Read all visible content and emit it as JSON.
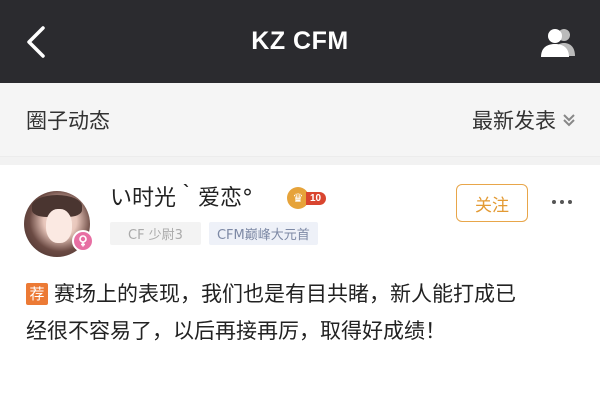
{
  "header": {
    "title": "KZ CFM",
    "back_icon": "chevron-left-icon",
    "members_icon": "members-icon"
  },
  "subheader": {
    "section_title": "圈子动态",
    "sort_label": "最新发表",
    "sort_icon": "double-chevron-down-icon"
  },
  "post": {
    "username": "い时光｀爱恋°",
    "vip_level": "10",
    "tags": [
      "CF 少尉3",
      "CFM巅峰大元首"
    ],
    "follow_label": "关注",
    "recommend_badge": "荐",
    "content": "赛场上的表现，我们也是有目共睹，新人能打成已经很不容易了，以后再接再厉，取得好成绩！"
  },
  "colors": {
    "header_bg": "#2b2b2f",
    "accent": "#e39a33",
    "badge": "#ec7a35"
  }
}
